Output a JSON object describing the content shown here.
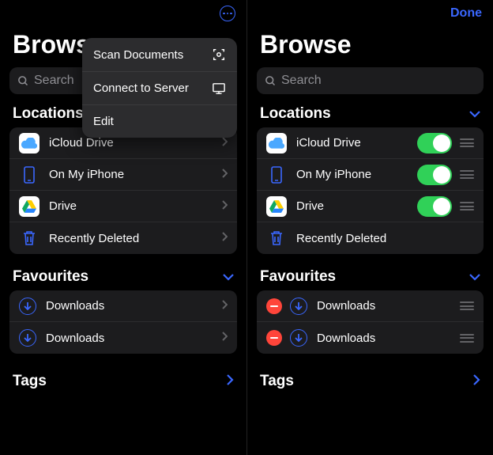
{
  "left": {
    "title": "Browse",
    "search_placeholder": "Search",
    "menu": {
      "scan": "Scan Documents",
      "connect": "Connect to Server",
      "edit": "Edit"
    },
    "locations_header": "Locations",
    "locations": [
      {
        "label": "iCloud Drive",
        "icon": "icloud"
      },
      {
        "label": "On My iPhone",
        "icon": "phone"
      },
      {
        "label": "Drive",
        "icon": "gdrive"
      },
      {
        "label": "Recently Deleted",
        "icon": "trash"
      }
    ],
    "favourites_header": "Favourites",
    "favourites": [
      {
        "label": "Downloads"
      },
      {
        "label": "Downloads"
      }
    ],
    "tags": "Tags"
  },
  "right": {
    "title": "Browse",
    "done": "Done",
    "search_placeholder": "Search",
    "locations_header": "Locations",
    "locations": [
      {
        "label": "iCloud Drive",
        "icon": "icloud",
        "toggle": true
      },
      {
        "label": "On My iPhone",
        "icon": "phone",
        "toggle": true
      },
      {
        "label": "Drive",
        "icon": "gdrive",
        "toggle": true
      },
      {
        "label": "Recently Deleted",
        "icon": "trash",
        "toggle": false
      }
    ],
    "favourites_header": "Favourites",
    "favourites": [
      {
        "label": "Downloads"
      },
      {
        "label": "Downloads"
      }
    ],
    "tags": "Tags"
  }
}
